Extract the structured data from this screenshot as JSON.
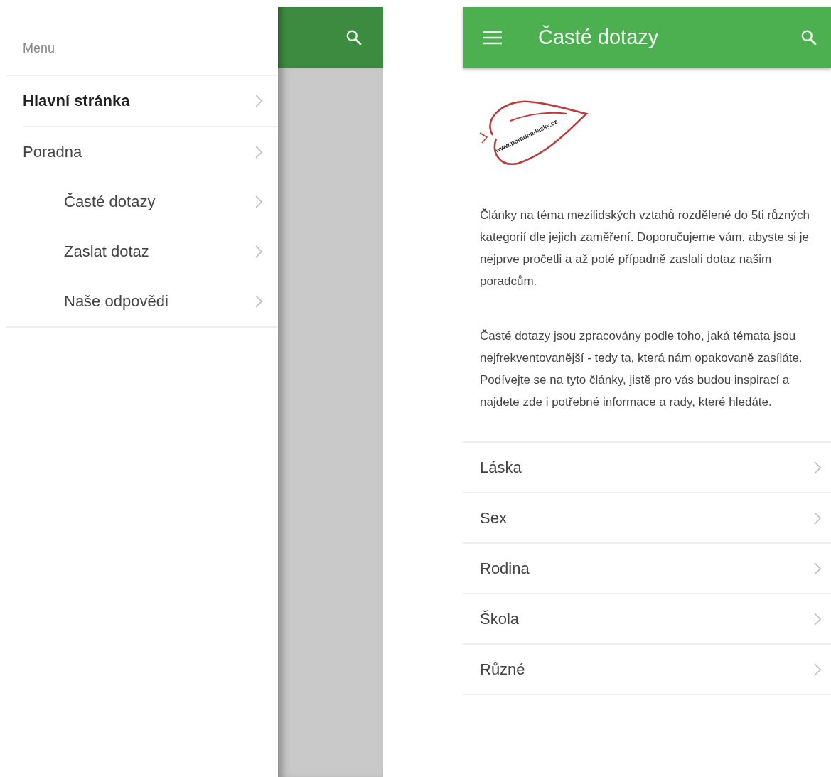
{
  "drawer_screen": {
    "menu_heading": "Menu",
    "items": [
      {
        "label": "Hlavní stránka",
        "selected": true
      },
      {
        "label": "Poradna",
        "selected": false,
        "children": [
          {
            "label": "Časté dotazy",
            "selected": false
          },
          {
            "label": "Zaslat dotaz",
            "selected": false
          },
          {
            "label": "Naše odpovědi",
            "selected": false
          }
        ]
      }
    ]
  },
  "main_screen": {
    "title": "Časté dotazy",
    "logo_text": "www.poradna-lasky.cz",
    "paragraphs": [
      "Články na téma mezilidských vztahů rozdělené do 5ti různých kategorií dle jejich zaměření. Doporučujeme vám, abyste si je nejprve pročetli a až poté případně zaslali dotaz našim poradcům.",
      "Časté dotazy jsou zpracovány podle toho, jaká témata jsou nejfrekventovanější - tedy ta, která nám opakovaně zasíláte. Podívejte se na tyto články, jistě pro vás budou inspirací a najdete zde i potřebné informace a rady, které hledáte."
    ],
    "categories": [
      "Láska",
      "Sex",
      "Rodina",
      "Škola",
      "Různé"
    ]
  }
}
